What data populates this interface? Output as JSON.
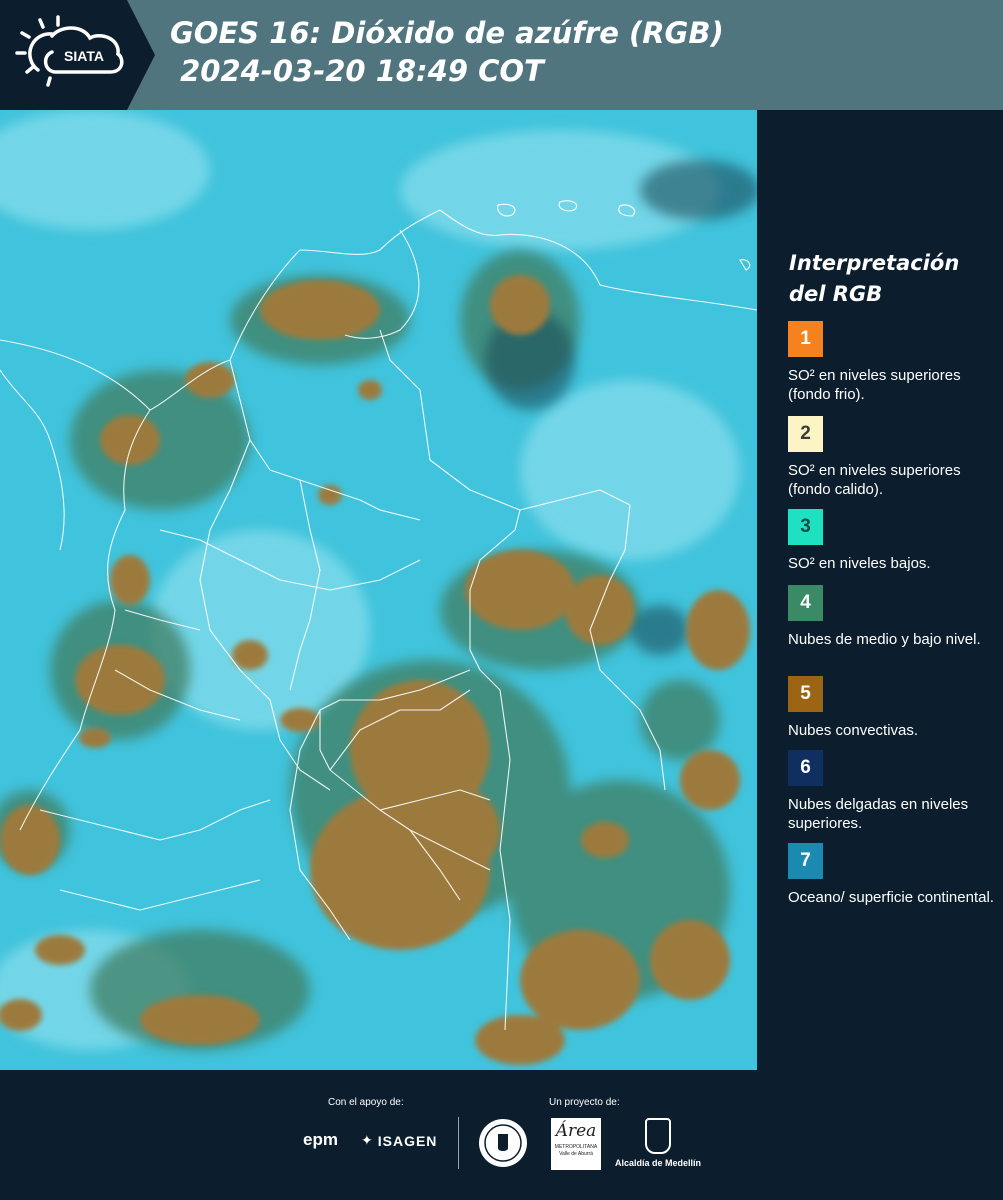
{
  "header": {
    "logo_text": "SIATA",
    "title_line1": "GOES 16: Dióxido de azúfre (RGB)",
    "title_line2": " 2024-03-20 18:49 COT"
  },
  "legend": {
    "title_line1": "Interpretación",
    "title_line2": "del RGB",
    "items": [
      {
        "number": "1",
        "label": "SO² en niveles superiores (fondo frio).",
        "color": "#f5821f"
      },
      {
        "number": "2",
        "label": "SO² en niveles superiores (fondo calido).",
        "color": "#fcf4c4"
      },
      {
        "number": "3",
        "label": "SO² en niveles bajos.",
        "color": "#1de1c1"
      },
      {
        "number": "4",
        "label": "Nubes de medio y bajo nivel.",
        "color": "#3a8a66"
      },
      {
        "number": "5",
        "label": "Nubes convectivas.",
        "color": "#9c6514"
      },
      {
        "number": "6",
        "label": "Nubes delgadas en niveles superiores.",
        "color": "#0f2f60"
      },
      {
        "number": "7",
        "label": "Oceano/ superficie continental.",
        "color": "#1a8ab0"
      }
    ]
  },
  "footer": {
    "support_label": "Con el apoyo de:",
    "project_label": "Un proyecto de:",
    "sponsors": [
      "epm",
      "ISAGEN"
    ],
    "partners": [
      "Área",
      "METROPOLITANA Valle de Aburrá",
      "Alcaldía de Medellín"
    ]
  },
  "colors": {
    "header_bg": "#50757f",
    "panel_bg": "#0c1e2d",
    "map_sky": "#40c3dc",
    "cloud_convective": "#9c7a3c",
    "cloud_midlevel": "#3f7e62"
  }
}
